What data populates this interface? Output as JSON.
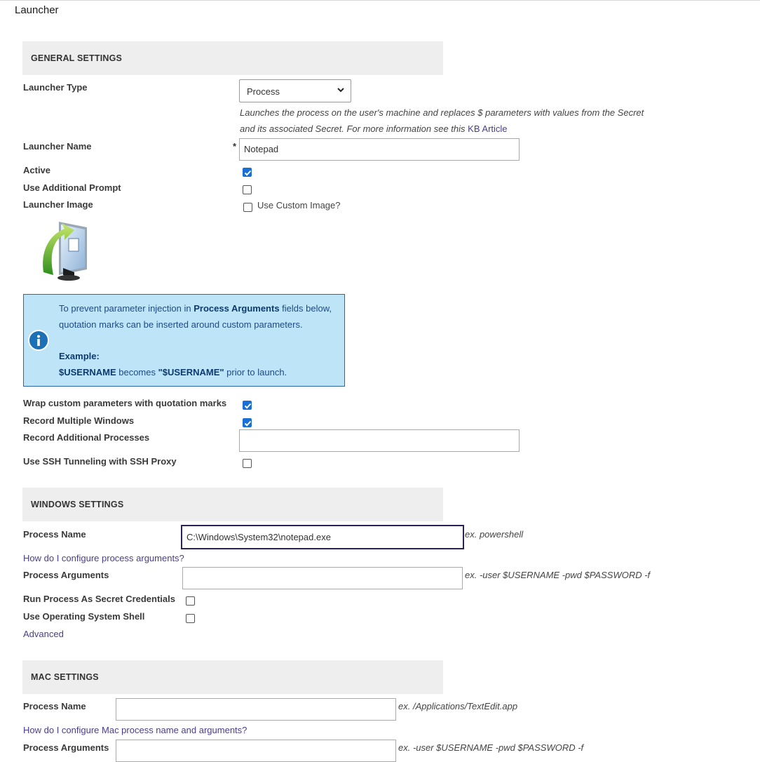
{
  "page": {
    "title": "Launcher"
  },
  "general": {
    "header": "GENERAL SETTINGS",
    "launcher_type_label": "Launcher Type",
    "launcher_type_value": "Process",
    "launcher_type_desc_line1": "Launches the process on the user's machine and replaces $ parameters with values from the Secret",
    "launcher_type_desc_line2": "and its associated Secret. For more information see this",
    "kb_link": "KB Article",
    "launcher_name_label": "Launcher Name",
    "required_marker": "*",
    "launcher_name_value": "Notepad",
    "active_label": "Active",
    "active_checked": true,
    "additional_prompt_label": "Use Additional Prompt",
    "additional_prompt_checked": false,
    "launcher_image_label": "Launcher Image",
    "custom_image_label": "Use Custom Image?",
    "custom_image_checked": false,
    "image_icon": "launcher-process-icon"
  },
  "info": {
    "line1_pre": "To prevent parameter injection in ",
    "line1_bold": "Process Arguments",
    "line1_post": " fields below,",
    "line2": "quotation marks can be inserted around custom parameters.",
    "example_label": "Example:",
    "example_var": "$USERNAME",
    "example_mid": " becomes ",
    "example_quoted": "\"$USERNAME\"",
    "example_post": " prior to launch.",
    "icon": "info-icon",
    "colors": {
      "background": "#bde4f7",
      "border": "#2a6aa0",
      "icon": "#1b70b6"
    }
  },
  "options": {
    "wrap_label": "Wrap custom parameters with quotation marks",
    "wrap_checked": true,
    "record_windows_label": "Record Multiple Windows",
    "record_windows_checked": true,
    "record_processes_label": "Record Additional Processes",
    "record_processes_value": "",
    "ssh_label": "Use SSH Tunneling with SSH Proxy",
    "ssh_checked": false
  },
  "windows": {
    "header": "WINDOWS SETTINGS",
    "process_name_label": "Process Name",
    "process_name_value": "C:\\Windows\\System32\\notepad.exe",
    "process_name_hint": "ex. powershell",
    "configure_link": "How do I configure process arguments?",
    "process_args_label": "Process Arguments",
    "process_args_value": "",
    "process_args_hint": "ex. -user $USERNAME -pwd $PASSWORD -f",
    "run_as_label": "Run Process As Secret Credentials",
    "run_as_checked": false,
    "os_shell_label": "Use Operating System Shell",
    "os_shell_checked": false,
    "advanced_link": "Advanced"
  },
  "mac": {
    "header": "MAC SETTINGS",
    "process_name_label": "Process Name",
    "process_name_value": "",
    "process_name_hint": "ex. /Applications/TextEdit.app",
    "configure_link": "How do I configure Mac process name and arguments?",
    "process_args_label": "Process Arguments",
    "process_args_value": "",
    "process_args_hint": "ex. -user $USERNAME -pwd $PASSWORD -f"
  },
  "colors": {
    "link": "#4a3d8f",
    "checkbox_checked": "#1a6fd6",
    "focus_border": "#2a2358",
    "section_bg": "#eeeeee"
  }
}
